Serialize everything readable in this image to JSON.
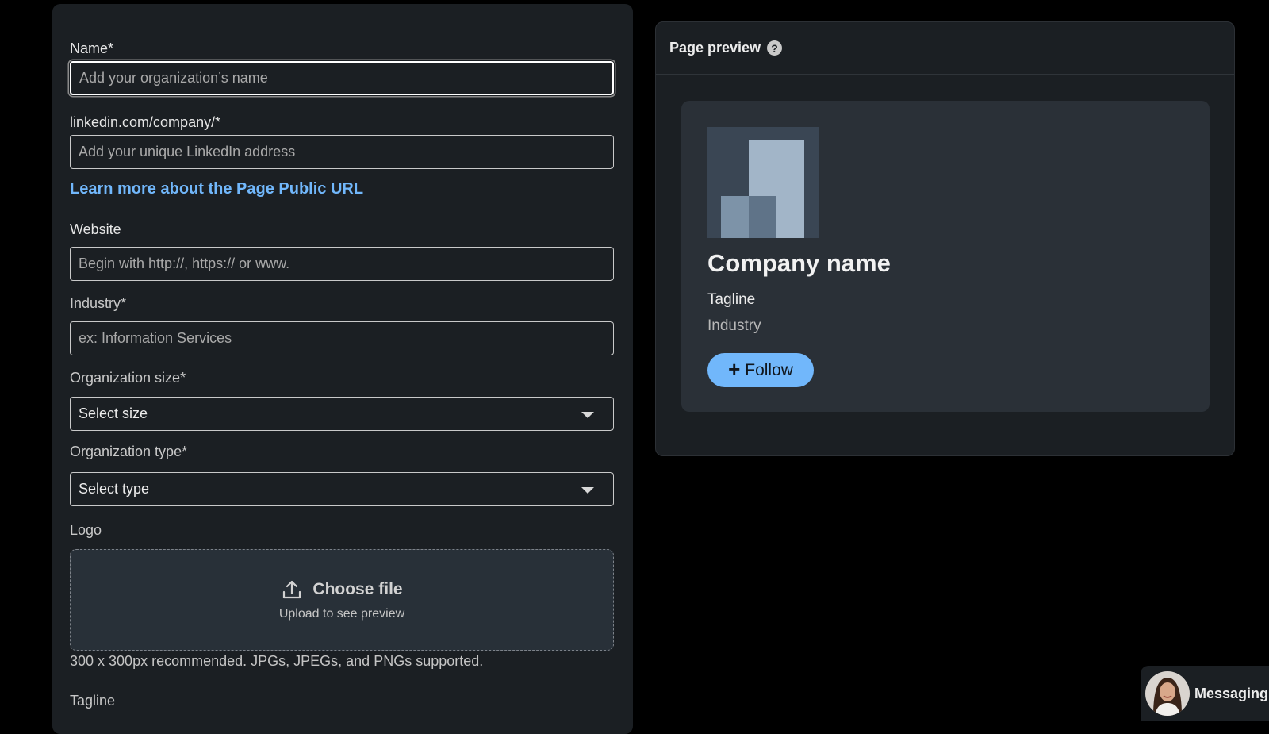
{
  "form": {
    "name": {
      "label": "Name*",
      "placeholder": "Add your organization’s name"
    },
    "company_url": {
      "label": "linkedin.com/company/*",
      "placeholder": "Add your unique LinkedIn address"
    },
    "learn_link": "Learn more about the Page Public URL",
    "website": {
      "label": "Website",
      "placeholder": "Begin with http://, https:// or www."
    },
    "industry": {
      "label": "Industry*",
      "placeholder": "ex: Information Services"
    },
    "org_size": {
      "label": "Organization size*",
      "selected": "Select size"
    },
    "org_type": {
      "label": "Organization type*",
      "selected": "Select type"
    },
    "logo": {
      "label": "Logo",
      "choose_label": "Choose file",
      "sub_label": "Upload to see preview",
      "hint": "300 x 300px recommended. JPGs, JPEGs, and PNGs supported."
    },
    "tagline": {
      "label": "Tagline"
    }
  },
  "preview": {
    "title": "Page preview",
    "help_glyph": "?",
    "company_name": "Company name",
    "tagline": "Tagline",
    "industry": "Industry",
    "follow_plus": "+",
    "follow_label": "Follow"
  },
  "messaging": {
    "label": "Messaging"
  },
  "colors": {
    "accent": "#71b7fb",
    "panel": "#1b1f23",
    "background": "#000000",
    "card": "#2a3037"
  },
  "icons": [
    "upload-icon",
    "help-icon",
    "chevron-down-icon",
    "plus-icon",
    "building-logo-icon",
    "avatar"
  ]
}
